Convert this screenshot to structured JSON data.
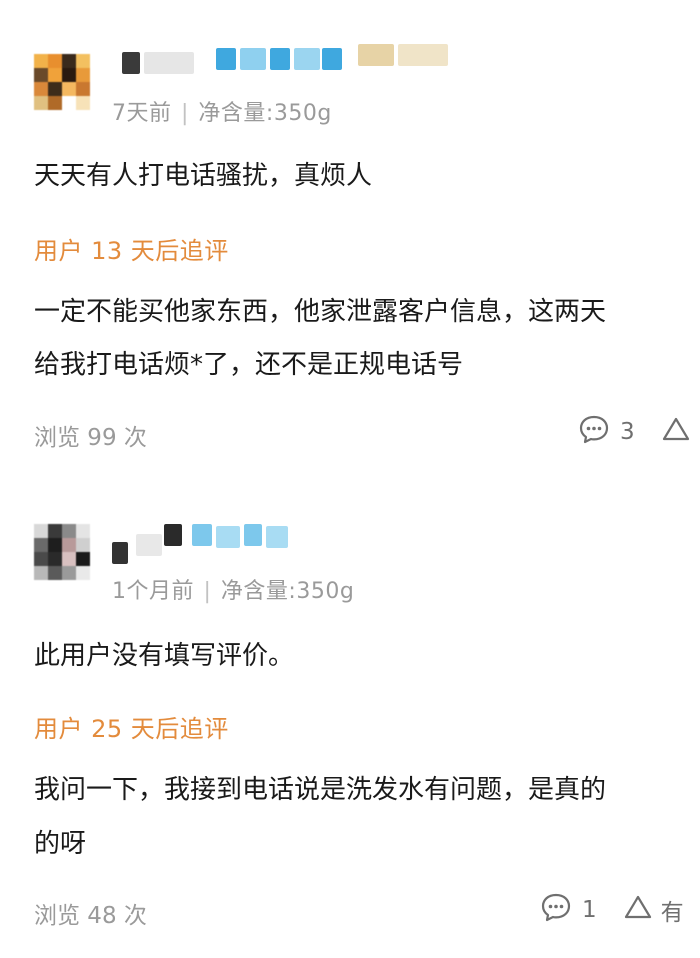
{
  "reviews": [
    {
      "time": "7天前",
      "separator": "|",
      "spec": "净含量:350g",
      "content": "天天有人打电话骚扰，真烦人",
      "followup_label": "用户 13 天后追评",
      "followup_lines": [
        "一定不能买他家东西，他家泄露客户信息，这两天",
        "给我打电话烦*了，还不是正规电话号"
      ],
      "views": "浏览 99 次",
      "comment_count": "3",
      "like_label": ""
    },
    {
      "time": "1个月前",
      "separator": "|",
      "spec": "净含量:350g",
      "content": "此用户没有填写评价。",
      "followup_label": "用户 25 天后追评",
      "followup_lines": [
        "我问一下，我接到电话说是洗发水有问题，是真的",
        "的呀"
      ],
      "views": "浏览 48 次",
      "comment_count": "1",
      "like_label": "有"
    }
  ],
  "colors": {
    "followup_accent": "#e38b3c",
    "meta_gray": "#9a9a9a",
    "text": "#1a1a1a",
    "name_blur_blue": "#7dc8ec"
  },
  "icons": {
    "comment": "comment-bubble-icon",
    "like": "like-triangle-icon"
  }
}
